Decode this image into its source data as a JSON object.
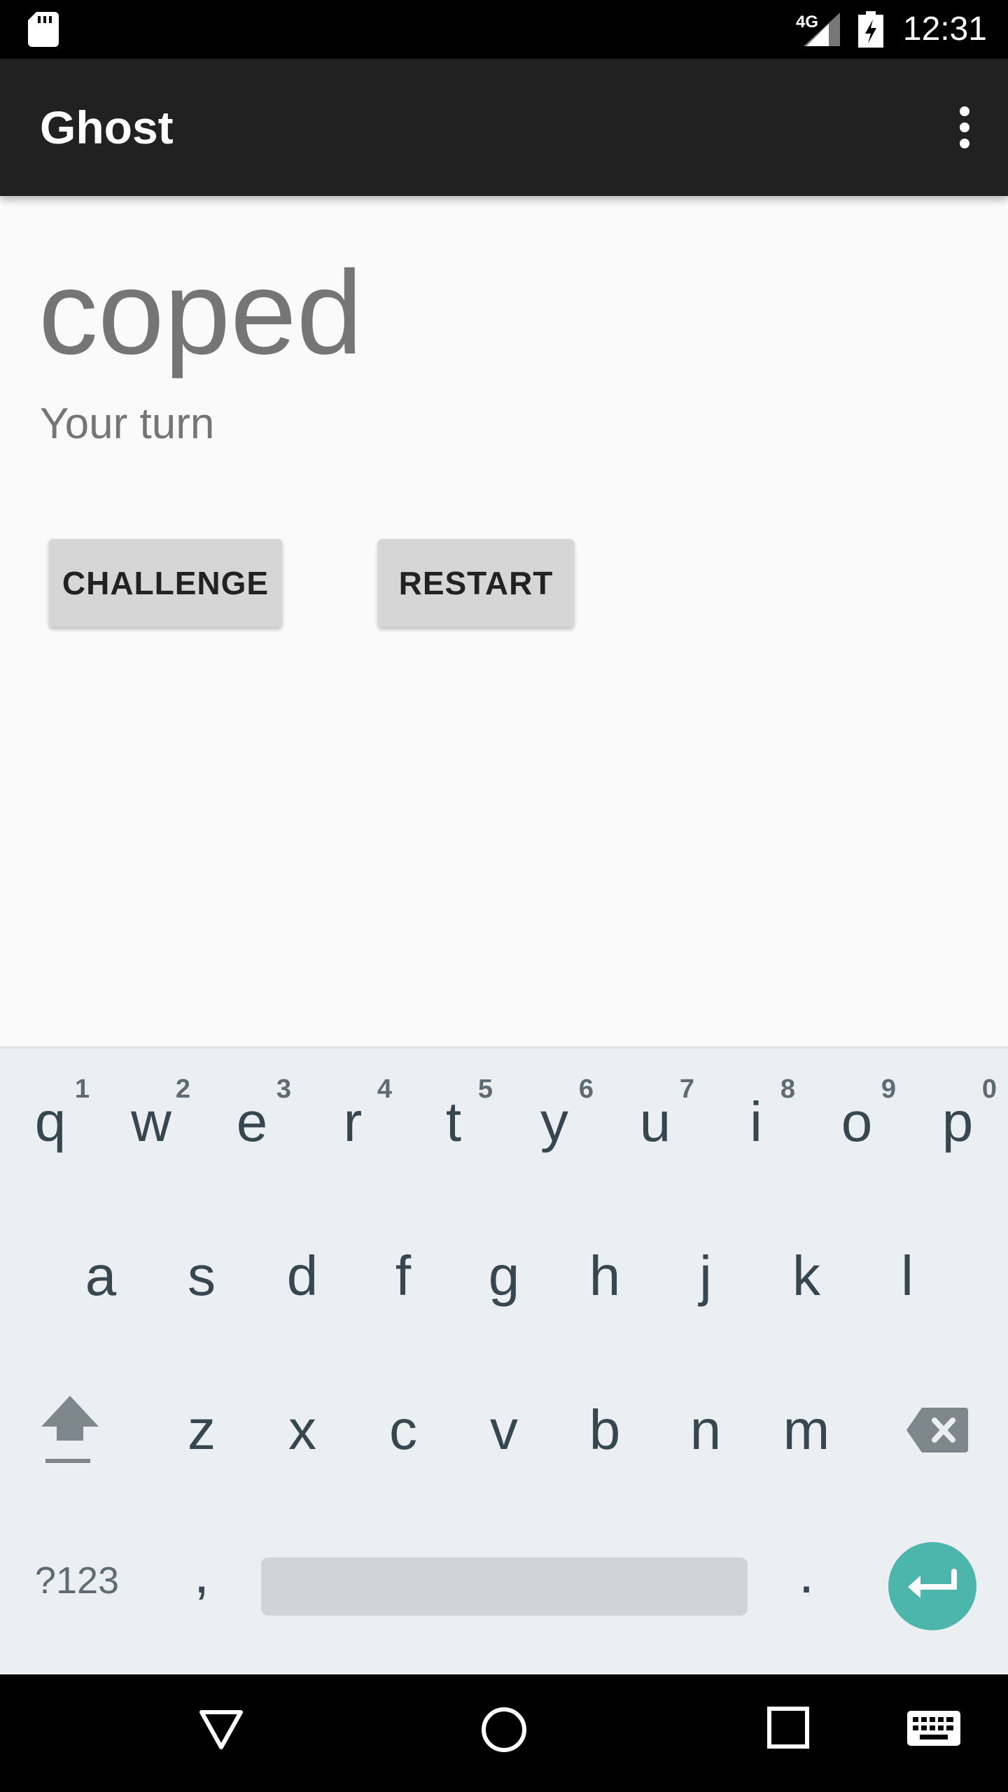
{
  "status_bar": {
    "network": "4G",
    "time": "12:31"
  },
  "app_bar": {
    "title": "Ghost"
  },
  "game": {
    "word": "coped",
    "status": "Your turn"
  },
  "buttons": {
    "challenge": "CHALLENGE",
    "restart": "RESTART"
  },
  "keyboard": {
    "row1": [
      {
        "key": "q",
        "hint": "1"
      },
      {
        "key": "w",
        "hint": "2"
      },
      {
        "key": "e",
        "hint": "3"
      },
      {
        "key": "r",
        "hint": "4"
      },
      {
        "key": "t",
        "hint": "5"
      },
      {
        "key": "y",
        "hint": "6"
      },
      {
        "key": "u",
        "hint": "7"
      },
      {
        "key": "i",
        "hint": "8"
      },
      {
        "key": "o",
        "hint": "9"
      },
      {
        "key": "p",
        "hint": "0"
      }
    ],
    "row2": [
      "a",
      "s",
      "d",
      "f",
      "g",
      "h",
      "j",
      "k",
      "l"
    ],
    "row3": [
      "z",
      "x",
      "c",
      "v",
      "b",
      "n",
      "m"
    ],
    "symbols_key": "?123",
    "comma_key": ",",
    "period_key": ".",
    "accent_color": "#4db6ac"
  }
}
